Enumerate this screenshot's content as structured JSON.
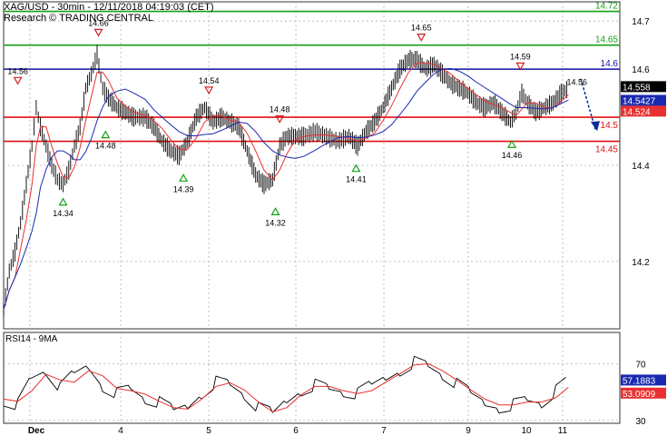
{
  "header": {
    "line1": "XAG/USD - 30min - 12/11/2018 04:19:03 (CET)",
    "line2": "Research © TRADING CENTRAL"
  },
  "chart_data": [
    {
      "type": "line",
      "instrument": "XAG/USD",
      "timeframe": "30min",
      "ylim": [
        14.06,
        14.74
      ],
      "y_ticks": [
        14.2,
        14.4,
        14.6,
        14.7
      ],
      "x_ticks": [
        "Dec",
        "4",
        "5",
        "6",
        "7",
        "9",
        "10",
        "11"
      ],
      "horizontal_levels": [
        {
          "value": 14.72,
          "label": "14.72",
          "color": "#16a016"
        },
        {
          "value": 14.65,
          "label": "14.65",
          "color": "#16a016"
        },
        {
          "value": 14.6,
          "label": "14.6",
          "color": "#1010a0"
        },
        {
          "value": 14.5,
          "label": "14.5",
          "color": "#e01010"
        },
        {
          "value": 14.45,
          "label": "14.45",
          "color": "#e01010"
        }
      ],
      "price_boxes": [
        {
          "value": 14.558,
          "label": "14.558",
          "color": "#000000"
        },
        {
          "value": 14.5427,
          "label": "14.5427",
          "color": "#1a2ab0"
        },
        {
          "value": 14.524,
          "label": "14.524",
          "color": "#e83030"
        }
      ],
      "pivots": [
        {
          "x": 0.1,
          "y": 14.56,
          "label": "14.56",
          "kind": "high"
        },
        {
          "x": 0.42,
          "y": 14.34,
          "label": "14.34",
          "kind": "low"
        },
        {
          "x": 0.67,
          "y": 14.66,
          "label": "14.66",
          "kind": "high"
        },
        {
          "x": 0.72,
          "y": 14.48,
          "label": "14.48",
          "kind": "low"
        },
        {
          "x": 1.27,
          "y": 14.39,
          "label": "14.39",
          "kind": "low"
        },
        {
          "x": 1.45,
          "y": 14.54,
          "label": "14.54",
          "kind": "high"
        },
        {
          "x": 1.92,
          "y": 14.32,
          "label": "14.32",
          "kind": "low"
        },
        {
          "x": 1.95,
          "y": 14.48,
          "label": "14.48",
          "kind": "high"
        },
        {
          "x": 2.49,
          "y": 14.41,
          "label": "14.41",
          "kind": "low"
        },
        {
          "x": 2.95,
          "y": 14.65,
          "label": "14.65",
          "kind": "high"
        },
        {
          "x": 3.59,
          "y": 14.46,
          "label": "14.46",
          "kind": "low"
        },
        {
          "x": 3.65,
          "y": 14.59,
          "label": "14.59",
          "kind": "high"
        },
        {
          "x": 4.05,
          "y": 14.56,
          "label": "14.56",
          "kind": "text"
        }
      ],
      "price_path": [
        [
          0.0,
          14.1
        ],
        [
          0.04,
          14.18
        ],
        [
          0.08,
          14.22
        ],
        [
          0.12,
          14.28
        ],
        [
          0.16,
          14.36
        ],
        [
          0.2,
          14.44
        ],
        [
          0.23,
          14.52
        ],
        [
          0.26,
          14.48
        ],
        [
          0.3,
          14.44
        ],
        [
          0.34,
          14.4
        ],
        [
          0.38,
          14.37
        ],
        [
          0.42,
          14.36
        ],
        [
          0.46,
          14.39
        ],
        [
          0.5,
          14.44
        ],
        [
          0.54,
          14.48
        ],
        [
          0.58,
          14.56
        ],
        [
          0.62,
          14.59
        ],
        [
          0.66,
          14.63
        ],
        [
          0.7,
          14.56
        ],
        [
          0.74,
          14.54
        ],
        [
          0.8,
          14.52
        ],
        [
          0.86,
          14.51
        ],
        [
          0.92,
          14.5
        ],
        [
          1.0,
          14.5
        ],
        [
          1.06,
          14.48
        ],
        [
          1.12,
          14.45
        ],
        [
          1.18,
          14.43
        ],
        [
          1.24,
          14.42
        ],
        [
          1.3,
          14.45
        ],
        [
          1.36,
          14.5
        ],
        [
          1.42,
          14.52
        ],
        [
          1.48,
          14.49
        ],
        [
          1.54,
          14.5
        ],
        [
          1.6,
          14.49
        ],
        [
          1.66,
          14.48
        ],
        [
          1.72,
          14.43
        ],
        [
          1.78,
          14.38
        ],
        [
          1.84,
          14.36
        ],
        [
          1.9,
          14.37
        ],
        [
          1.95,
          14.44
        ],
        [
          2.0,
          14.46
        ],
        [
          2.06,
          14.46
        ],
        [
          2.12,
          14.46
        ],
        [
          2.2,
          14.47
        ],
        [
          2.28,
          14.46
        ],
        [
          2.36,
          14.45
        ],
        [
          2.44,
          14.46
        ],
        [
          2.5,
          14.44
        ],
        [
          2.56,
          14.47
        ],
        [
          2.62,
          14.49
        ],
        [
          2.68,
          14.52
        ],
        [
          2.74,
          14.56
        ],
        [
          2.8,
          14.6
        ],
        [
          2.86,
          14.62
        ],
        [
          2.92,
          14.62
        ],
        [
          2.98,
          14.6
        ],
        [
          3.04,
          14.61
        ],
        [
          3.1,
          14.59
        ],
        [
          3.16,
          14.57
        ],
        [
          3.22,
          14.56
        ],
        [
          3.28,
          14.55
        ],
        [
          3.34,
          14.53
        ],
        [
          3.4,
          14.52
        ],
        [
          3.46,
          14.53
        ],
        [
          3.52,
          14.51
        ],
        [
          3.58,
          14.49
        ],
        [
          3.62,
          14.51
        ],
        [
          3.66,
          14.55
        ],
        [
          3.7,
          14.53
        ],
        [
          3.76,
          14.51
        ],
        [
          3.82,
          14.52
        ],
        [
          3.88,
          14.53
        ],
        [
          3.94,
          14.55
        ],
        [
          3.99,
          14.56
        ]
      ]
    },
    {
      "type": "line",
      "title": "RSI14 - 9MA",
      "ylim": [
        28,
        92
      ],
      "y_ticks": [
        30,
        70
      ],
      "value_boxes": [
        {
          "value": 57.1883,
          "label": "57.1883",
          "color": "#1a2ab0"
        },
        {
          "value": 53.0909,
          "label": "53.0909",
          "color": "#e83030"
        }
      ],
      "rsi_path": [
        [
          0.0,
          45
        ],
        [
          0.1,
          42
        ],
        [
          0.2,
          60
        ],
        [
          0.3,
          65
        ],
        [
          0.4,
          52
        ],
        [
          0.5,
          62
        ],
        [
          0.6,
          68
        ],
        [
          0.7,
          55
        ],
        [
          0.8,
          50
        ],
        [
          0.9,
          52
        ],
        [
          1.0,
          45
        ],
        [
          1.1,
          42
        ],
        [
          1.2,
          36
        ],
        [
          1.3,
          40
        ],
        [
          1.4,
          50
        ],
        [
          1.5,
          58
        ],
        [
          1.6,
          55
        ],
        [
          1.7,
          48
        ],
        [
          1.8,
          38
        ],
        [
          1.9,
          34
        ],
        [
          2.0,
          44
        ],
        [
          2.1,
          52
        ],
        [
          2.2,
          56
        ],
        [
          2.3,
          52
        ],
        [
          2.4,
          50
        ],
        [
          2.5,
          48
        ],
        [
          2.6,
          54
        ],
        [
          2.7,
          60
        ],
        [
          2.8,
          66
        ],
        [
          2.9,
          72
        ],
        [
          3.0,
          68
        ],
        [
          3.1,
          62
        ],
        [
          3.2,
          55
        ],
        [
          3.3,
          48
        ],
        [
          3.4,
          42
        ],
        [
          3.5,
          40
        ],
        [
          3.6,
          42
        ],
        [
          3.7,
          44
        ],
        [
          3.8,
          42
        ],
        [
          3.9,
          50
        ],
        [
          3.99,
          57
        ]
      ]
    }
  ]
}
